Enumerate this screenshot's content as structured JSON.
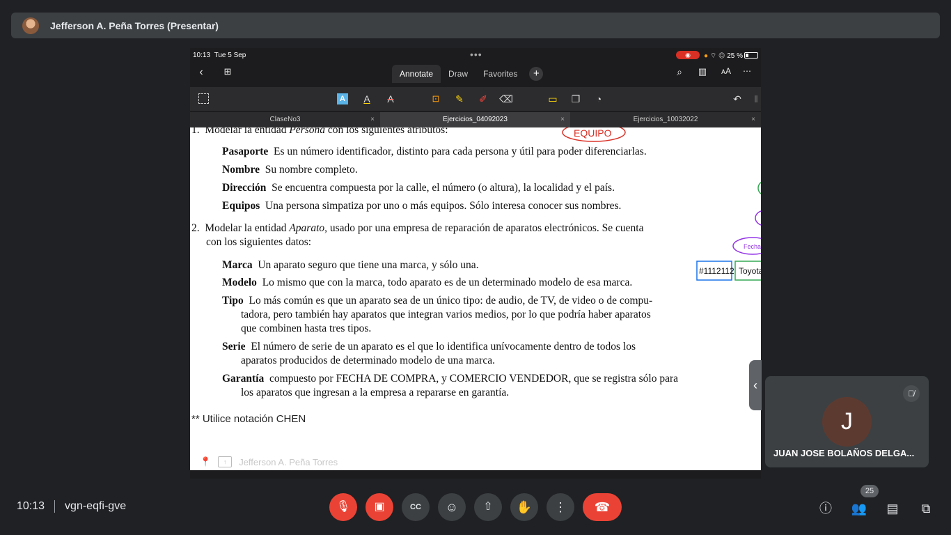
{
  "presenter": {
    "name": "Jefferson A. Peña Torres (Presentar)"
  },
  "ipad": {
    "status": {
      "time": "10:13",
      "date": "Tue 5 Sep",
      "dots": "•••",
      "rec": "◉",
      "battery": "25 %"
    },
    "mode_tabs": [
      "Annotate",
      "Draw",
      "Favorites"
    ],
    "add_label": "+",
    "doc_tabs": [
      "ClaseNo3",
      "Ejercicios_04092023",
      "Ejercicios_10032022"
    ],
    "tab_close": "×"
  },
  "document": {
    "item1": {
      "num": "1.",
      "pre": "Modelar la entidad ",
      "em": "Persona",
      "post": " con los siguientes atributos:"
    },
    "persona_attrs": [
      {
        "term": "Pasaporte",
        "desc": "Es un número identificador, distinto para cada persona y útil para poder diferenciarlas."
      },
      {
        "term": "Nombre",
        "desc": "Su nombre completo."
      },
      {
        "term": "Dirección",
        "desc": "Se encuentra compuesta por la calle, el número (o altura), la localidad y el país."
      },
      {
        "term": "Equipos",
        "desc": "Una persona simpatiza por uno o más equipos. Sólo interesa conocer sus nombres."
      }
    ],
    "item2": {
      "num": "2.",
      "pre": "Modelar la entidad ",
      "em": "Aparato",
      "post": ", usado por una empresa de reparación de aparatos electrónicos. Se cuenta",
      "line2": "con los siguientes datos:"
    },
    "aparato_attrs": [
      {
        "term": "Marca",
        "lines": [
          "Un aparato seguro que tiene una marca, y sólo una."
        ]
      },
      {
        "term": "Modelo",
        "lines": [
          "Lo mismo que con la marca, todo aparato es de un determinado modelo de esa marca."
        ]
      },
      {
        "term": "Tipo",
        "lines": [
          "Lo más común es que un aparato sea de un único tipo: de audio, de TV, de video o de compu-",
          "tadora, pero también hay aparatos que integran varios medios, por lo que podría haber aparatos",
          "que combinen hasta tres tipos."
        ]
      },
      {
        "term": "Serie",
        "lines": [
          "El número de serie de un aparato es el que lo identifica unívocamente dentro de todos los",
          "aparatos producidos de determinado modelo de una marca."
        ]
      },
      {
        "term": "Garantía",
        "lines": [
          "compuesto por FECHA DE COMPRA, y COMERCIO VENDEDOR, que se registra sólo para",
          "los aparatos que ingresan a la empresa a repararse en garantía."
        ]
      }
    ],
    "note": "** Utilice notación CHEN",
    "handwriting": {
      "equipo": "EQUIPO",
      "fecha": "Fecha",
      "numbers": "#1112112",
      "toyota": "Toyota"
    },
    "footer_name": "Jefferson A. Peña Torres"
  },
  "participant": {
    "initial": "J",
    "name": "JUAN JOSE BOLAÑOS DELGA..."
  },
  "meeting": {
    "time": "10:13",
    "code": "vgn-eqfi-gve",
    "people_count": "25"
  },
  "controls": {
    "captions": "CC"
  },
  "colors": {
    "end_call": "#ea4335",
    "tile_bg": "#3c4043",
    "avatar": "#5d3a30"
  }
}
